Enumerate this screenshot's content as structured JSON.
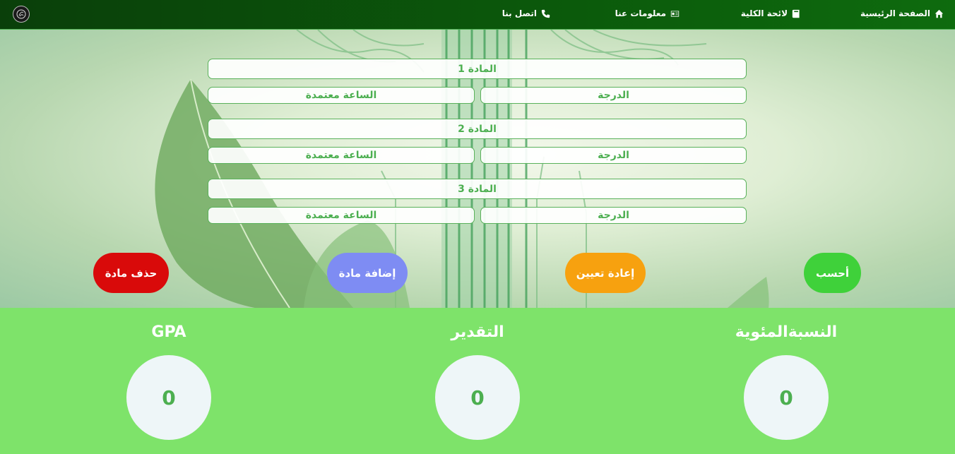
{
  "nav": {
    "home": "الصفحة الرئيسية",
    "college": "لائحة الكلية",
    "about": "معلومات عنا",
    "contact": "اتصل بنا"
  },
  "subjects": [
    {
      "title": "المادة 1",
      "grade_placeholder": "الدرجة",
      "hours_placeholder": "الساعة معتمدة"
    },
    {
      "title": "المادة 2",
      "grade_placeholder": "الدرجة",
      "hours_placeholder": "الساعة معتمدة"
    },
    {
      "title": "المادة 3",
      "grade_placeholder": "الدرجة",
      "hours_placeholder": "الساعة معتمدة"
    }
  ],
  "buttons": {
    "calculate": "أحسب",
    "reset": "إعادة تعيين",
    "add": "إضافة مادة",
    "delete": "حذف مادة"
  },
  "results": {
    "percentage_label": "النسبةالمئوية",
    "percentage_value": "0",
    "grade_label": "التقدير",
    "grade_value": "0",
    "gpa_label": "GPA",
    "gpa_value": "0"
  },
  "colors": {
    "navbar": "#0b5a0b",
    "accent_green": "#4caf50",
    "results_bg": "#7ee36a",
    "calculate": "#3fd13a",
    "reset": "#f7a10f",
    "add": "#7e8cf3",
    "delete": "#d90a0a"
  }
}
